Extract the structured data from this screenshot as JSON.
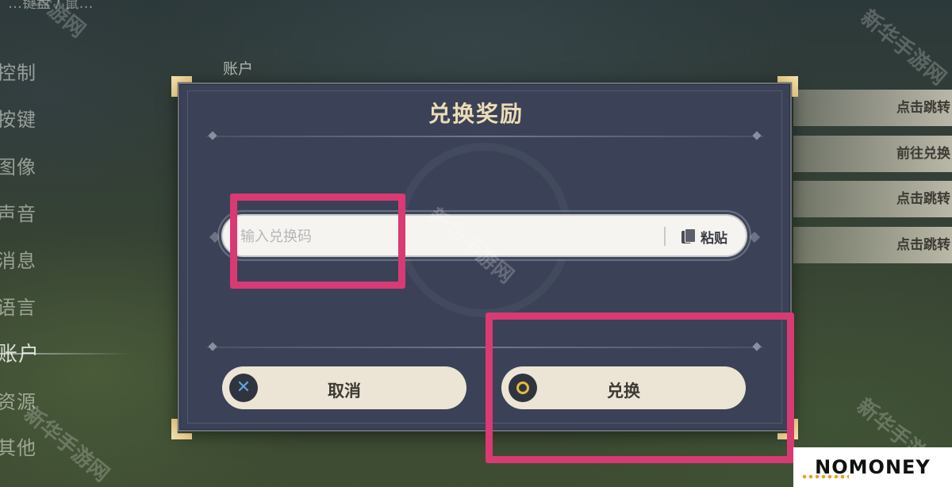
{
  "side_menu": {
    "top_cut": "…键盘 / 鼠…",
    "items": [
      "控制",
      "按键",
      "图像",
      "声音",
      "消息",
      "语言",
      "账户",
      "资源",
      "其他"
    ],
    "active_index": 6
  },
  "section_label": "账户",
  "right_list": [
    "点击跳转",
    "前往兑换",
    "点击跳转",
    "点击跳转"
  ],
  "dialog": {
    "title": "兑换奖励",
    "input": {
      "placeholder": "输入兑换码",
      "value": ""
    },
    "paste_label": "粘贴",
    "cancel_label": "取消",
    "confirm_label": "兑换"
  },
  "watermark": "新华手游网",
  "logo": "NOMONEY",
  "colors": {
    "dialog_bg": "#3b4257",
    "title_gold": "#ecdcb6",
    "highlight": "#d93a73",
    "button_bg": "#ece5d6",
    "cancel_icon": "#5fa6e0",
    "confirm_icon": "#e3bb3d"
  },
  "icons": {
    "cancel": "x-icon",
    "confirm": "circle-icon",
    "paste": "clipboard-icon"
  }
}
